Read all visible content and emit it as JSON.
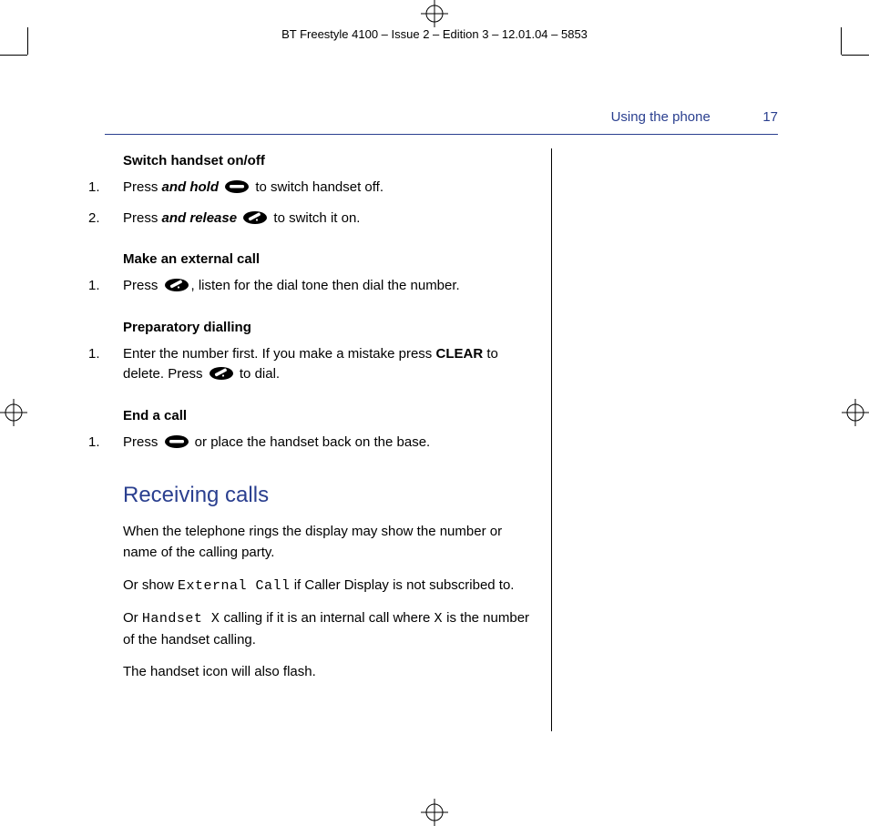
{
  "doc_header": "BT Freestyle 4100 – Issue 2 – Edition 3 – 12.01.04 – 5853",
  "running_head": {
    "section": "Using the phone",
    "page": "17"
  },
  "s1": {
    "heading": "Switch handset on/off",
    "step1_a": "Press ",
    "step1_b": "and hold",
    "step1_c": " to switch handset off.",
    "step2_a": "Press ",
    "step2_b": "and release",
    "step2_c": " to switch it on."
  },
  "s2": {
    "heading": "Make an external call",
    "step1_a": "Press ",
    "step1_b": ", listen for the dial tone then dial the number."
  },
  "s3": {
    "heading": "Preparatory dialling",
    "step1_a": "Enter the number first. If you make a mistake press ",
    "step1_b": "CLEAR",
    "step1_c": " to delete. Press ",
    "step1_d": " to dial."
  },
  "s4": {
    "heading": "End a call",
    "step1_a": "Press ",
    "step1_b": " or place the handset back on the base."
  },
  "receiving": {
    "title": "Receiving calls",
    "p1": "When the telephone rings the display may show the number or name of the calling party.",
    "p2_a": "Or show ",
    "p2_lcd": "External Call",
    "p2_b": " if Caller Display is not subscribed to.",
    "p3_a": "Or ",
    "p3_lcd1": "Handset X",
    "p3_b": " calling if it is an internal call where ",
    "p3_lcd2": "X",
    "p3_c": " is the number of the handset calling.",
    "p4": "The handset icon will also flash."
  },
  "idx": {
    "one": "1.",
    "two": "2."
  }
}
